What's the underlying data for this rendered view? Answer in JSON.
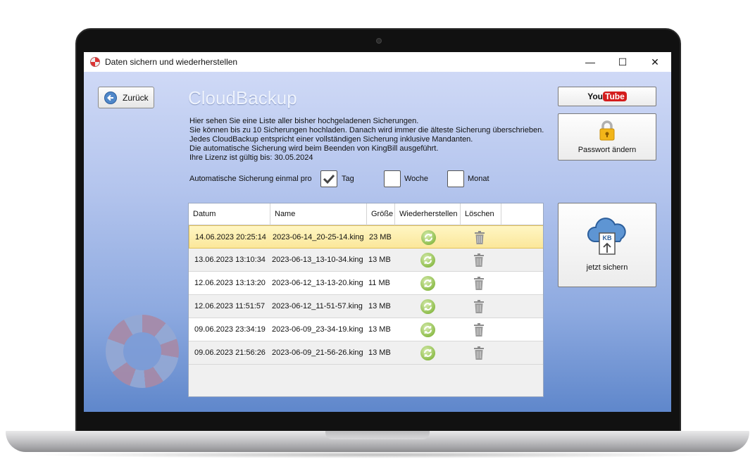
{
  "window": {
    "title": "Daten sichern und wiederherstellen"
  },
  "controls": {
    "minimize": "—",
    "maximize": "☐",
    "close": "✕"
  },
  "back_button": {
    "label": "Zurück"
  },
  "heading": "CloudBackup",
  "info_lines": [
    "Hier sehen Sie eine Liste aller bisher hochgeladenen Sicherungen.",
    "Sie können bis zu 10 Sicherungen hochladen. Danach wird immer die älteste Sicherung überschrieben.",
    "Jedes CloudBackup entspricht einer vollständigen Sicherung inklusive Mandanten.",
    "Die automatische Sicherung wird beim Beenden von KingBill ausgeführt.",
    "Ihre Lizenz ist gültig bis: 30.05.2024"
  ],
  "auto_backup": {
    "label": "Automatische Sicherung einmal pro",
    "options": [
      {
        "label": "Tag",
        "checked": true
      },
      {
        "label": "Woche",
        "checked": false
      },
      {
        "label": "Monat",
        "checked": false
      }
    ]
  },
  "table": {
    "columns": [
      "Datum",
      "Name",
      "Größe",
      "Wiederherstellen",
      "Löschen"
    ],
    "rows": [
      {
        "datum": "14.06.2023 20:25:14",
        "name": "2023-06-14_20-25-14.king",
        "groesse": "23 MB",
        "selected": true
      },
      {
        "datum": "13.06.2023 13:10:34",
        "name": "2023-06-13_13-10-34.king",
        "groesse": "13 MB",
        "selected": false
      },
      {
        "datum": "12.06.2023 13:13:20",
        "name": "2023-06-12_13-13-20.king",
        "groesse": "11 MB",
        "selected": false
      },
      {
        "datum": "12.06.2023 11:51:57",
        "name": "2023-06-12_11-51-57.king",
        "groesse": "13 MB",
        "selected": false
      },
      {
        "datum": "09.06.2023 23:34:19",
        "name": "2023-06-09_23-34-19.king",
        "groesse": "13 MB",
        "selected": false
      },
      {
        "datum": "09.06.2023 21:56:26",
        "name": "2023-06-09_21-56-26.king",
        "groesse": "13 MB",
        "selected": false
      }
    ]
  },
  "youtube_button": {
    "you": "You",
    "tube": "Tube"
  },
  "password_button": {
    "label": "Passwort ändern",
    "icon": "lock-icon"
  },
  "backup_button": {
    "label": "jetzt sichern",
    "icon": "cloud-upload-icon",
    "badge": "KB"
  },
  "colors": {
    "accent": "#5f87cb",
    "selection": "#fbe79a",
    "restore": "#8fbe4d"
  }
}
